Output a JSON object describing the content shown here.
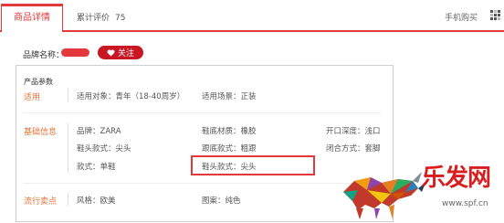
{
  "tabs": {
    "active_label": "商品详情",
    "reviews_label": "累计评价",
    "reviews_count": "75",
    "mobile_buy_label": "手机购买"
  },
  "brand": {
    "label": "品牌名称：",
    "follow_label": "关注"
  },
  "params": {
    "title": "产品参数",
    "groups": [
      {
        "category": "适用",
        "cells": [
          "适用对象：青年（18-40周岁）",
          "适用场景：正装"
        ]
      },
      {
        "category": "基础信息",
        "cells": [
          "品牌：ZARA",
          "鞋底材质：橡胶",
          "开口深度：浅口",
          "鞋头款式：尖头",
          "跟底款式：粗跟",
          "闭合方式：套脚",
          "款式：单鞋",
          "鞋头款式：尖头"
        ]
      },
      {
        "category": "流行卖点",
        "cells": [
          "风格：欧美",
          "图案：纯色"
        ]
      }
    ]
  },
  "watermark": {
    "text": "乐发网",
    "url": "www.spf.cn"
  },
  "colors": {
    "accent": "#e4393c",
    "button": "#c81623",
    "category": "#e57236"
  }
}
